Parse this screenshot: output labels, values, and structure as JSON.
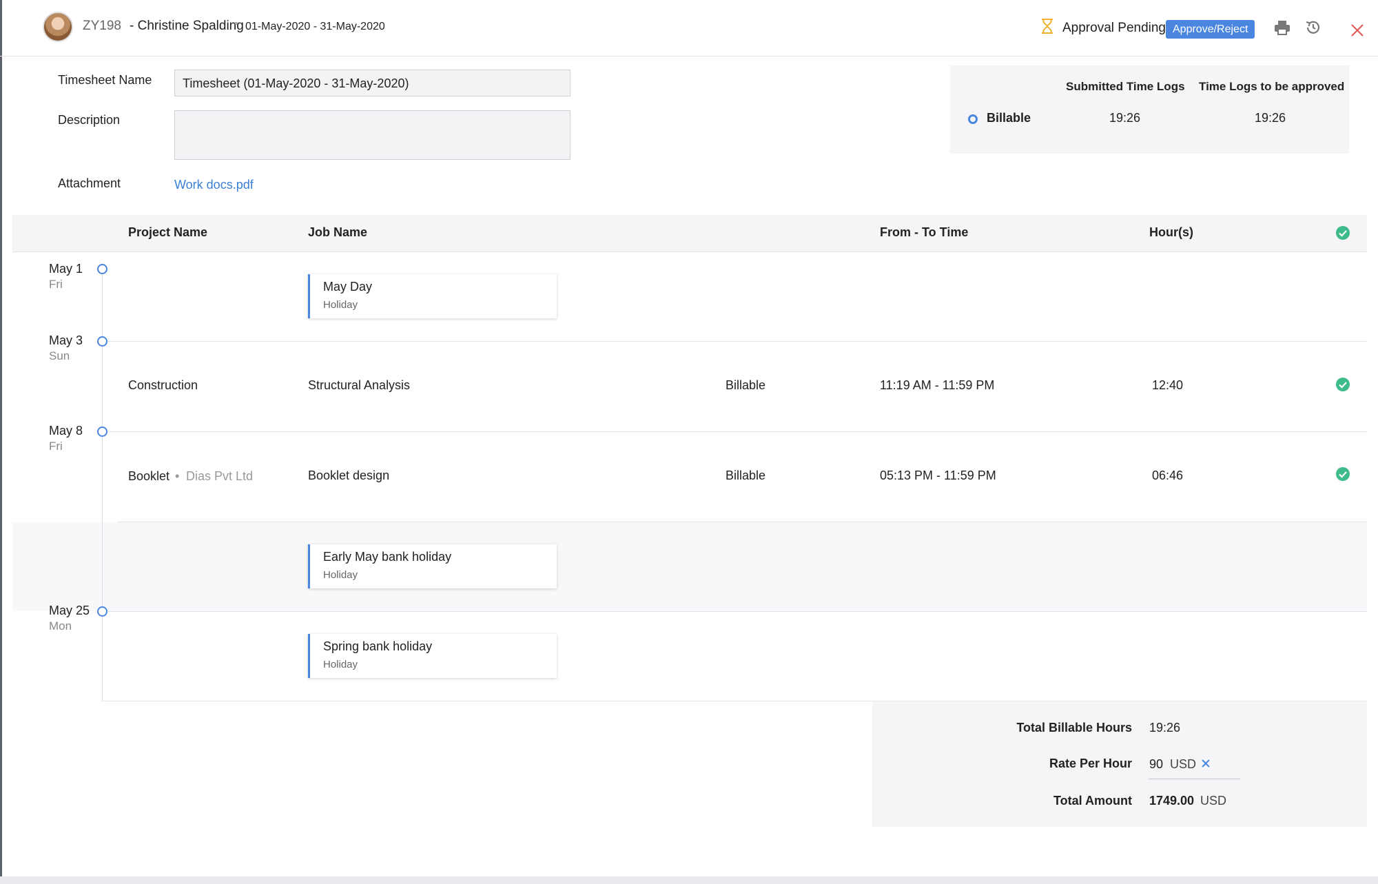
{
  "header": {
    "employee_id": "ZY198",
    "employee_name": "- Christine Spalding",
    "separator": "•",
    "period": "01-May-2020 - 31-May-2020",
    "status": "Approval Pending",
    "approve_label": "Approve/Reject",
    "icons": [
      "hourglass-icon",
      "print-icon",
      "history-icon",
      "close-icon"
    ],
    "colors": {
      "accent": "#4a86e0",
      "close": "#e25a5a",
      "hourglass": "#f0b030"
    }
  },
  "form": {
    "name_label": "Timesheet Name",
    "name_value": "Timesheet (01-May-2020 - 31-May-2020)",
    "description_label": "Description",
    "description_value": "",
    "attachment_label": "Attachment",
    "attachment_link": "Work docs.pdf"
  },
  "summary": {
    "col_submitted": "Submitted Time Logs",
    "col_to_approve": "Time Logs to be approved",
    "row_label": "Billable",
    "submitted": "19:26",
    "to_approve": "19:26"
  },
  "table": {
    "headers": {
      "project": "Project Name",
      "job": "Job Name",
      "time": "From - To Time",
      "hours": "Hour(s)"
    },
    "dates": [
      {
        "date": "May 1",
        "day": "Fri"
      },
      {
        "date": "May 3",
        "day": "Sun"
      },
      {
        "date": "May 8",
        "day": "Fri"
      },
      {
        "date": "May 25",
        "day": "Mon"
      }
    ],
    "holidays": [
      {
        "title": "May Day",
        "sub": "Holiday"
      },
      {
        "title": "Early May bank holiday",
        "sub": "Holiday"
      },
      {
        "title": "Spring bank holiday",
        "sub": "Holiday"
      }
    ],
    "logs": [
      {
        "project": "Construction",
        "client": "",
        "job": "Structural Analysis",
        "billing": "Billable",
        "time": "11:19 AM - 11:59 PM",
        "hours": "12:40"
      },
      {
        "project": "Booklet",
        "client": "Dias Pvt Ltd",
        "job": "Booklet design",
        "billing": "Billable",
        "time": "05:13 PM - 11:59 PM",
        "hours": "06:46"
      }
    ]
  },
  "totals": {
    "billable_label": "Total Billable Hours",
    "billable_value": "19:26",
    "rate_label": "Rate Per Hour",
    "rate_value": "90",
    "rate_currency": "USD",
    "amount_label": "Total Amount",
    "amount_value": "1749.00",
    "amount_currency": "USD"
  }
}
